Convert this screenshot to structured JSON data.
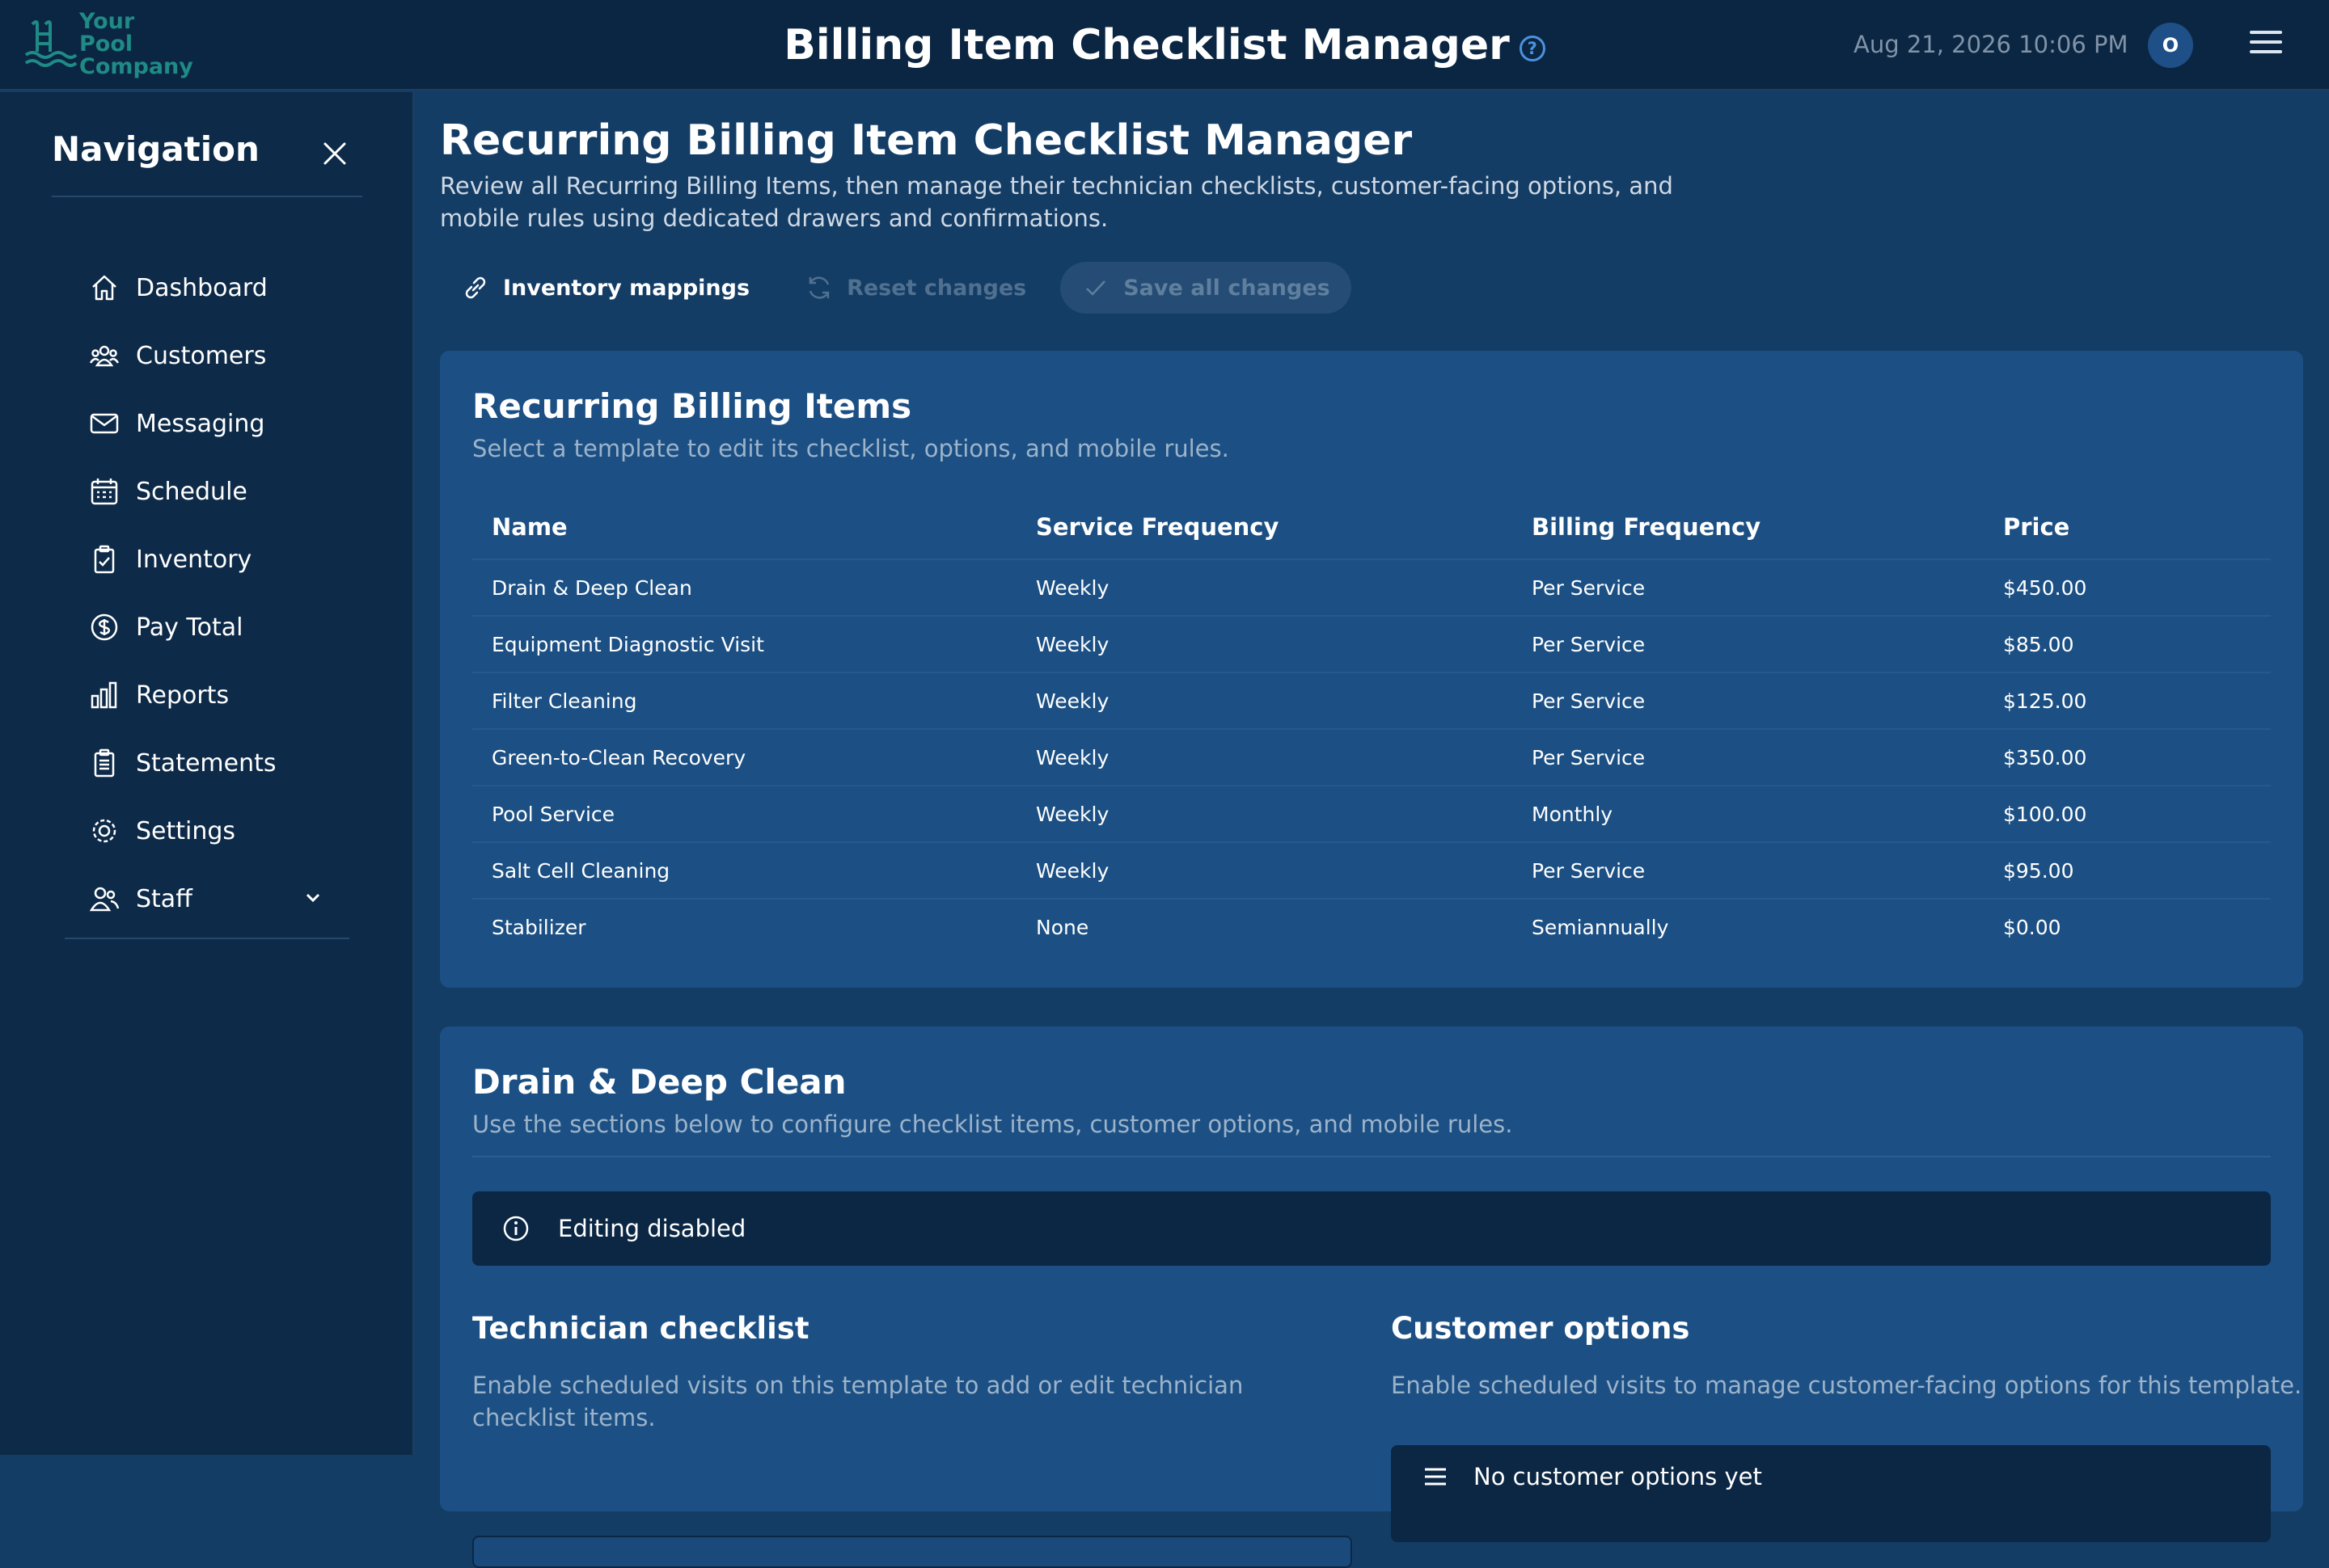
{
  "header": {
    "logo_text": "Your Pool Company",
    "title": "Billing Item Checklist Manager",
    "help_icon": "question-circle-icon",
    "datetime": "Aug 21, 2026 10:06 PM",
    "avatar_initial": "O",
    "menu_icon": "hamburger-menu-icon"
  },
  "sidebar": {
    "title": "Navigation",
    "items": [
      {
        "label": "Dashboard",
        "icon": "home-icon"
      },
      {
        "label": "Customers",
        "icon": "users-icon"
      },
      {
        "label": "Messaging",
        "icon": "envelope-icon"
      },
      {
        "label": "Schedule",
        "icon": "calendar-icon"
      },
      {
        "label": "Inventory",
        "icon": "clipboard-check-icon"
      },
      {
        "label": "Pay Total",
        "icon": "dollar-circle-icon"
      },
      {
        "label": "Reports",
        "icon": "bar-chart-icon"
      },
      {
        "label": "Statements",
        "icon": "documents-icon"
      },
      {
        "label": "Settings",
        "icon": "gear-icon"
      },
      {
        "label": "Staff",
        "icon": "staff-icon"
      }
    ]
  },
  "main": {
    "title": "Recurring Billing Item Checklist Manager",
    "description": "Review all Recurring Billing Items, then manage their technician checklists, customer-facing options, and mobile rules using dedicated drawers and confirmations.",
    "actions": {
      "inventory_mappings": "Inventory mappings",
      "reset_changes": "Reset changes",
      "save_all": "Save all changes"
    },
    "items_card": {
      "title": "Recurring Billing Items",
      "subtitle": "Select a template to edit its checklist, options, and mobile rules.",
      "columns": [
        "Name",
        "Service Frequency",
        "Billing Frequency",
        "Price"
      ],
      "rows": [
        [
          "Drain & Deep Clean",
          "Weekly",
          "Per Service",
          "$450.00"
        ],
        [
          "Equipment Diagnostic Visit",
          "Weekly",
          "Per Service",
          "$85.00"
        ],
        [
          "Filter Cleaning",
          "Weekly",
          "Per Service",
          "$125.00"
        ],
        [
          "Green-to-Clean Recovery",
          "Weekly",
          "Per Service",
          "$350.00"
        ],
        [
          "Pool Service",
          "Weekly",
          "Monthly",
          "$100.00"
        ],
        [
          "Salt Cell Cleaning",
          "Weekly",
          "Per Service",
          "$95.00"
        ],
        [
          "Stabilizer",
          "None",
          "Semiannually",
          "$0.00"
        ]
      ]
    },
    "detail_card": {
      "title": "Drain & Deep Clean",
      "subtitle": "Use the sections below to configure checklist items, customer options, and mobile rules.",
      "notice": "Editing disabled",
      "technician_checklist": {
        "title": "Technician checklist",
        "description": "Enable scheduled visits on this template to add or edit technician checklist items."
      },
      "customer_options": {
        "title": "Customer options",
        "description": "Enable scheduled visits to manage customer-facing options for this template.",
        "empty": "No customer options yet"
      }
    }
  },
  "colors": {
    "page_bg": "#143d66",
    "topbar_bg": "#0b2642",
    "sidebar_bg": "#0d2a48",
    "card_bg": "#1c5084",
    "accent": "#4b92e0",
    "logo": "#1f8a86"
  }
}
